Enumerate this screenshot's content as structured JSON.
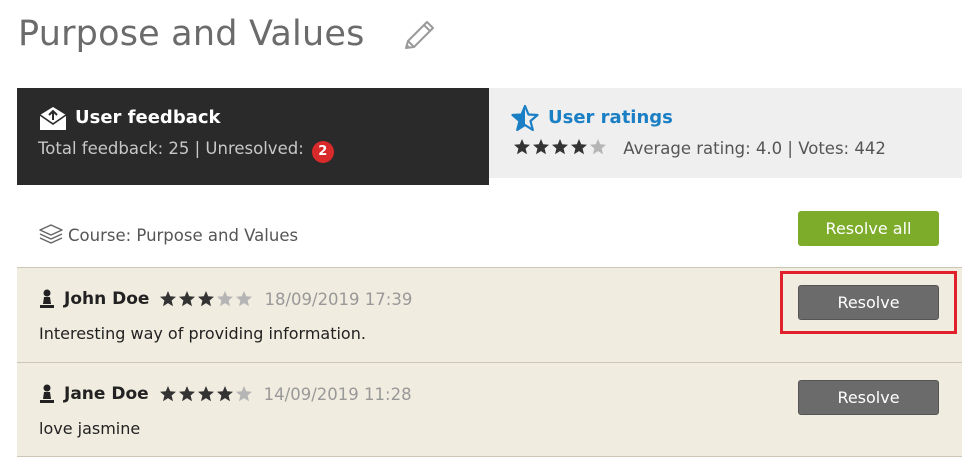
{
  "page": {
    "title": "Purpose and Values"
  },
  "tabs": {
    "feedback": {
      "title": "User feedback",
      "total_label": "Total feedback: 25 | Unresolved:",
      "unresolved_count": "2"
    },
    "ratings": {
      "title": "User ratings",
      "stars_filled": 4,
      "stars_total": 5,
      "summary": "Average rating: 4.0 | Votes: 442"
    }
  },
  "course": {
    "label": "Course: Purpose and Values"
  },
  "actions": {
    "resolve_all_label": "Resolve all"
  },
  "feedback_items": [
    {
      "user": "John Doe",
      "rating": 3,
      "date": "18/09/2019 17:39",
      "comment": "Interesting way of providing information.",
      "button_label": "Resolve"
    },
    {
      "user": "Jane Doe",
      "rating": 4,
      "date": "14/09/2019 11:28",
      "comment": "love jasmine",
      "button_label": "Resolve"
    }
  ],
  "colors": {
    "accent_blue": "#1a7fc4",
    "resolve_all_green": "#7cac2a",
    "badge_red": "#d8292b",
    "highlight_red": "#e0202a",
    "star_filled": "#333333",
    "star_empty": "#b5b5b5"
  },
  "icons": {
    "edit": "pencil-icon",
    "feedback": "envelope-upload-icon",
    "ratings": "star-outline-icon",
    "course": "stack-icon",
    "user": "pawn-user-icon"
  }
}
